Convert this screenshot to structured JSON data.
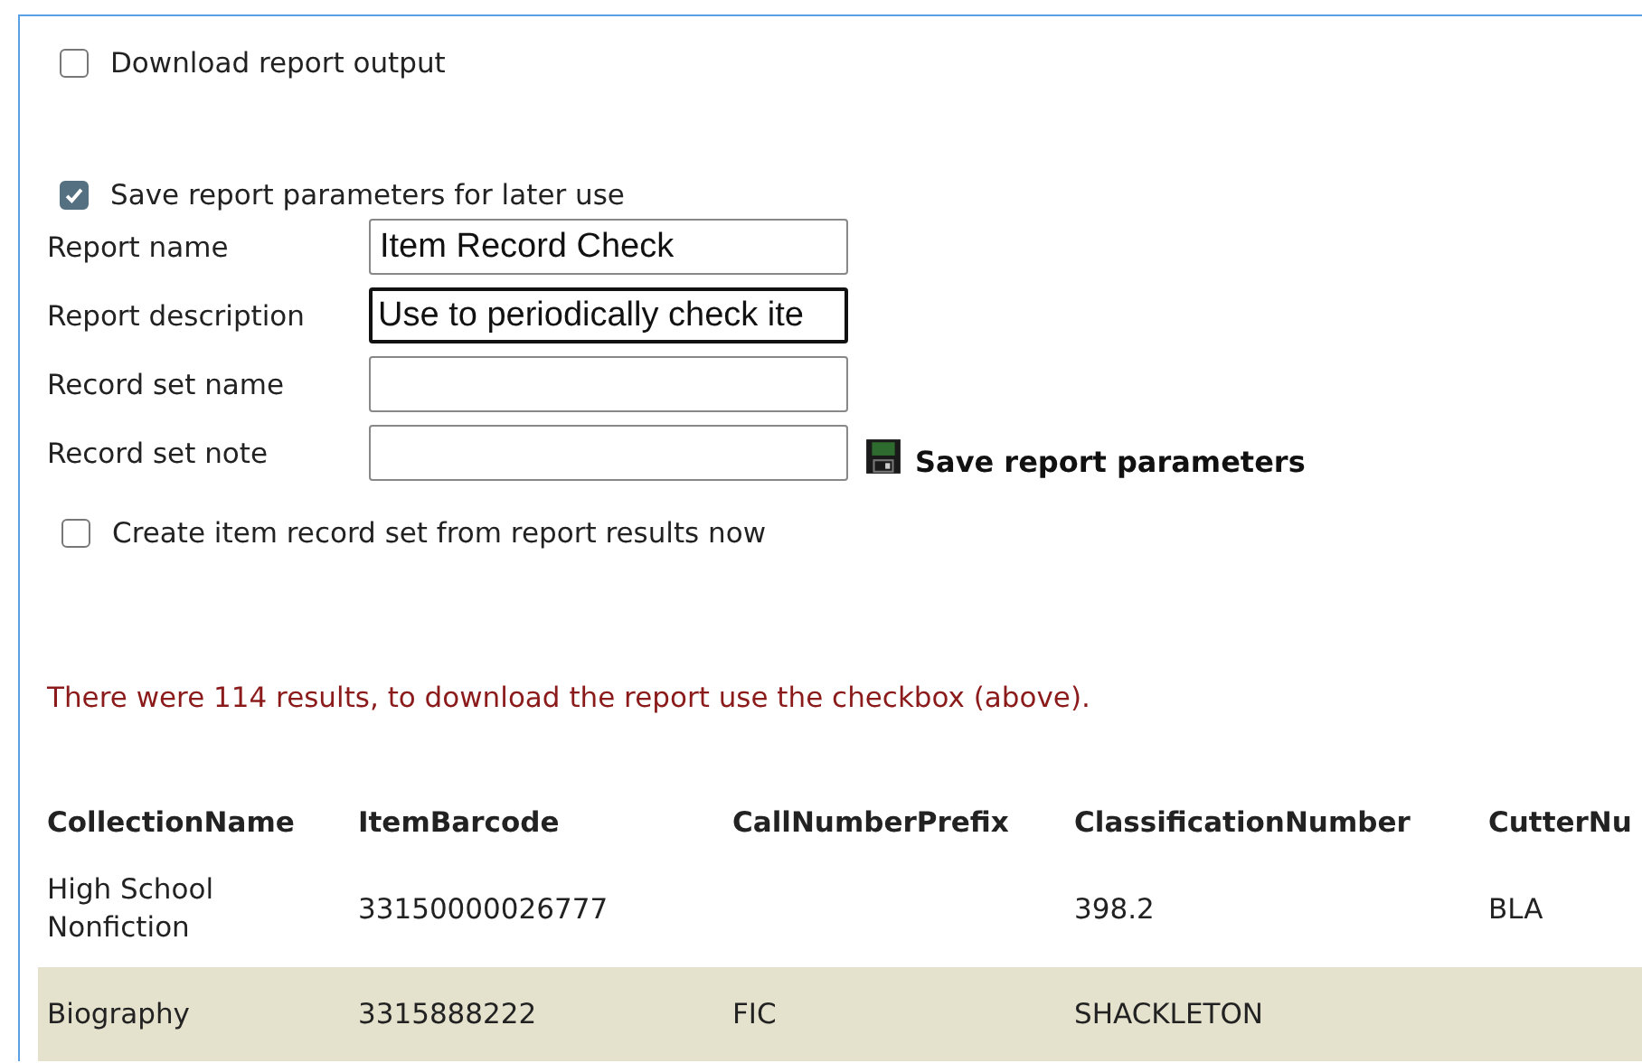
{
  "download_option": {
    "label": "Download report output",
    "checked": false
  },
  "save_option": {
    "label": "Save report parameters for later use",
    "checked": true
  },
  "form_fields": [
    {
      "label": "Report name",
      "value": "Item Record Check",
      "focused": false
    },
    {
      "label": "Report description",
      "value": "Use to periodically check ite",
      "focused": true
    },
    {
      "label": "Record set name",
      "focused": false
    },
    {
      "label": "Record set note",
      "focused": false
    }
  ],
  "save_button": {
    "label": "Save report parameters"
  },
  "record_set_option": {
    "label": "Create item record set from report results now",
    "checked": false
  },
  "message": "There were 114 results, to download the report use the checkbox (above).",
  "table": {
    "columns": [
      "CollectionName",
      "ItemBarcode",
      "CallNumberPrefix",
      "ClassificationNumber",
      "CutterNu"
    ],
    "rows": [
      [
        "High School Nonfiction",
        "33150000026777",
        "",
        "398.2",
        "BLA"
      ],
      [
        "Biography",
        "3315888222",
        "FIC",
        "SHACKLETON",
        ""
      ]
    ]
  }
}
